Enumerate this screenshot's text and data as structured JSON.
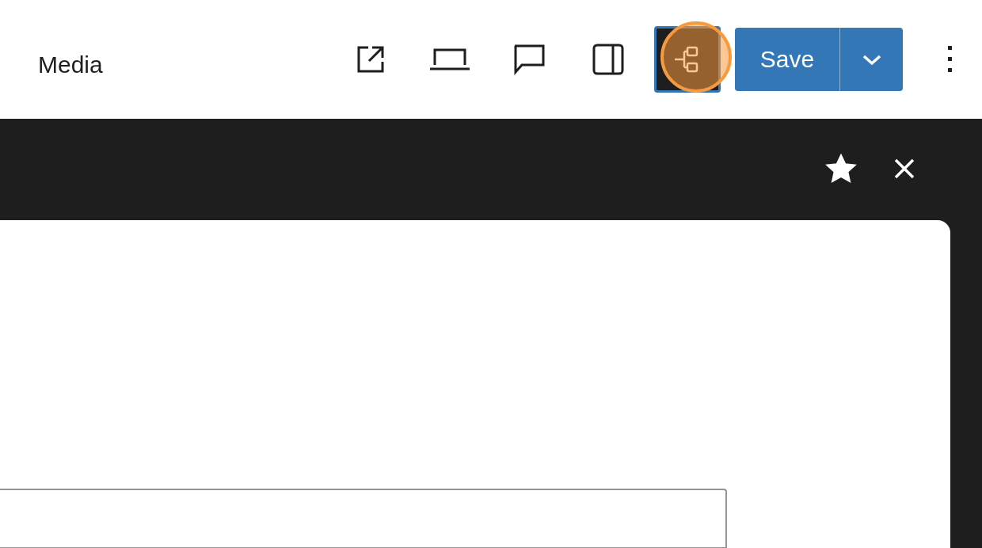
{
  "header": {
    "title": "Media",
    "tools": [
      {
        "kind": "external",
        "pressed": false
      },
      {
        "kind": "laptop",
        "pressed": false
      },
      {
        "kind": "comment",
        "pressed": false
      },
      {
        "kind": "sidebar",
        "pressed": false
      },
      {
        "kind": "structure",
        "pressed": true,
        "highlighted": true
      }
    ],
    "save_button": {
      "label": "Save"
    }
  },
  "panel": {
    "favorite": true
  }
}
